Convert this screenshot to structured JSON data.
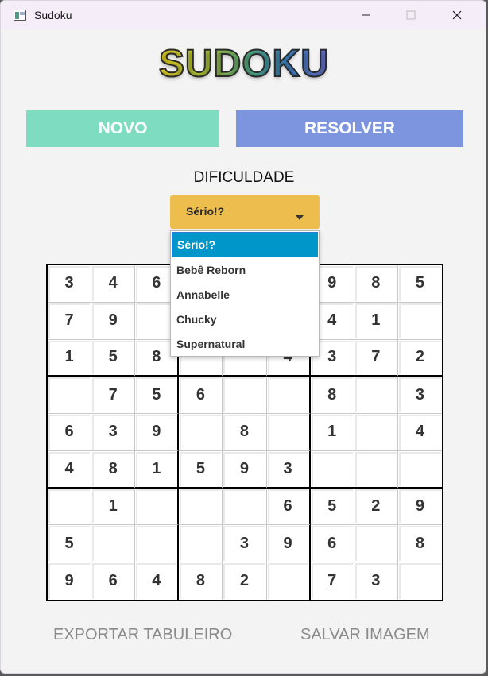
{
  "window": {
    "title": "Sudoku"
  },
  "logo": "SUDOKU",
  "buttons": {
    "novo": "NOVO",
    "resolver": "RESOLVER"
  },
  "difficulty": {
    "label": "DIFICULDADE",
    "selected": "Sério!?",
    "options": [
      "Sério!?",
      "Bebê Reborn",
      "Annabelle",
      "Chucky",
      "Supernatural"
    ]
  },
  "board": {
    "rows": [
      [
        "3",
        "4",
        "6",
        "",
        "",
        "",
        "9",
        "8",
        "5"
      ],
      [
        "7",
        "9",
        "",
        "",
        "",
        "",
        "4",
        "1",
        ""
      ],
      [
        "1",
        "5",
        "8",
        "",
        "",
        "4",
        "3",
        "7",
        "2"
      ],
      [
        "",
        "7",
        "5",
        "6",
        "",
        "",
        "8",
        "",
        "3"
      ],
      [
        "6",
        "3",
        "9",
        "",
        "8",
        "",
        "1",
        "",
        "4"
      ],
      [
        "4",
        "8",
        "1",
        "5",
        "9",
        "3",
        "",
        "",
        ""
      ],
      [
        "",
        "1",
        "",
        "",
        "",
        "6",
        "5",
        "2",
        "9"
      ],
      [
        "5",
        "",
        "",
        "",
        "3",
        "9",
        "6",
        "",
        "8"
      ],
      [
        "9",
        "6",
        "4",
        "8",
        "2",
        "",
        "7",
        "3",
        ""
      ]
    ]
  },
  "actions": {
    "export": "EXPORTAR TABULEIRO",
    "save_image": "SALVAR IMAGEM"
  },
  "colors": {
    "novo": "#7edcc1",
    "resolver": "#7d94df",
    "combo": "#edbd4d",
    "selected_option": "#0096c9"
  }
}
